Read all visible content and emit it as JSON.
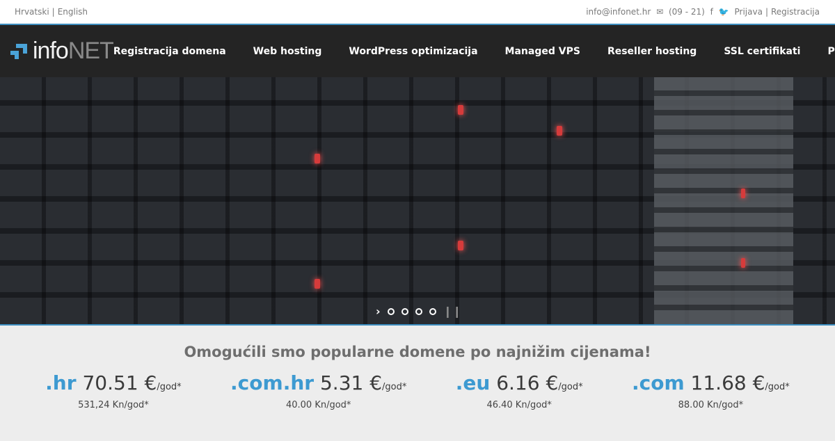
{
  "topbar": {
    "lang_hr": "Hrvatski",
    "lang_sep": "|",
    "lang_en": "English",
    "email": "info@infonet.hr",
    "hours": "(09 - 21)",
    "login": "Prijava",
    "sep": "|",
    "register": "Registracija"
  },
  "logo": {
    "info": "info",
    "net": "NET"
  },
  "nav": [
    "Registracija domena",
    "Web hosting",
    "WordPress optimizacija",
    "Managed VPS",
    "Reseller hosting",
    "SSL certifikati",
    "Podrška"
  ],
  "promo": {
    "title": "Omogućili smo popularne domene po najnižim cijenama!",
    "prices": [
      {
        "tld": ".hr",
        "price": "70.51 €",
        "unit": "/god*",
        "kn": "531,24 Kn/god*"
      },
      {
        "tld": ".com.hr",
        "price": "5.31 €",
        "unit": "/god*",
        "kn": "40.00 Kn/god*"
      },
      {
        "tld": ".eu",
        "price": "6.16 €",
        "unit": "/god*",
        "kn": "46.40 Kn/god*"
      },
      {
        "tld": ".com",
        "price": "11.68 €",
        "unit": "/god*",
        "kn": "88.00 Kn/god*"
      }
    ]
  },
  "accent": "#3d9ad1"
}
